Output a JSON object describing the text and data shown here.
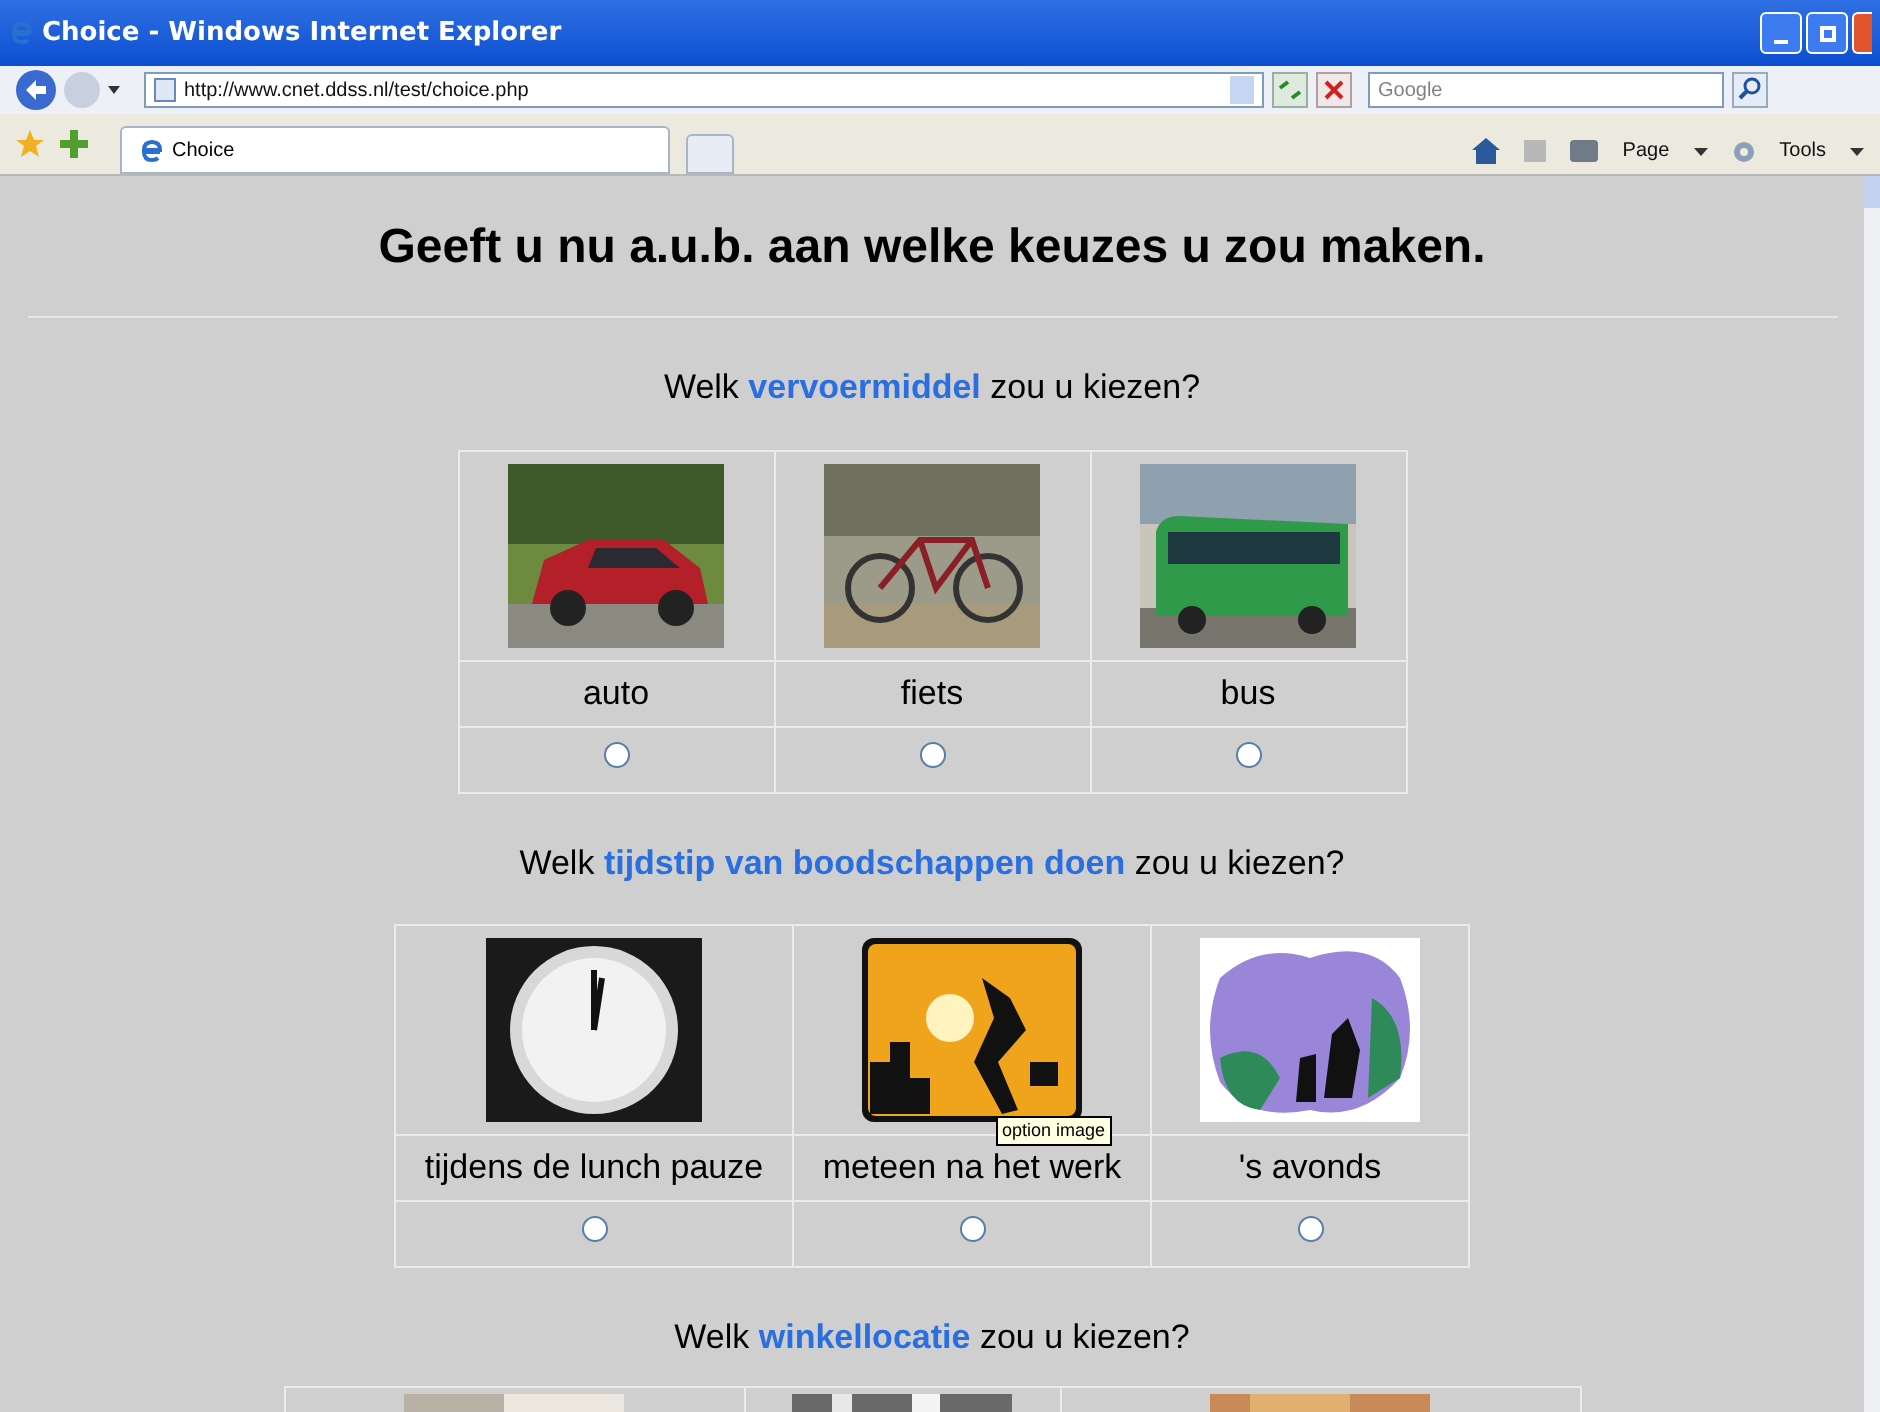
{
  "window": {
    "title": "Choice - Windows Internet Explorer"
  },
  "address_bar": {
    "url": "http://www.cnet.ddss.nl/test/choice.php"
  },
  "search": {
    "placeholder": "Google"
  },
  "tabs": [
    {
      "label": "Choice",
      "selected": true
    }
  ],
  "toolbar": {
    "page": "Page",
    "tools": "Tools"
  },
  "heading": "Geeft u nu a.u.b. aan welke keuzes u zou maken.",
  "questions": [
    {
      "prefix": "Welk",
      "keyword": "vervoermiddel",
      "suffix": "zou u kiezen?",
      "options": [
        {
          "label": "auto",
          "selected": false
        },
        {
          "label": "fiets",
          "selected": false
        },
        {
          "label": "bus",
          "selected": false
        }
      ]
    },
    {
      "prefix": "Welk",
      "keyword": "tijdstip van boodschappen doen",
      "suffix": "zou u kiezen?",
      "options": [
        {
          "label": "tijdens de lunch pauze",
          "selected": false
        },
        {
          "label": "meteen na het werk",
          "selected": false
        },
        {
          "label": "'s avonds",
          "selected": false
        }
      ]
    },
    {
      "prefix": "Welk",
      "keyword": "winkellocatie",
      "suffix": "zou u kiezen?"
    }
  ],
  "tooltip": {
    "text": "option image"
  }
}
